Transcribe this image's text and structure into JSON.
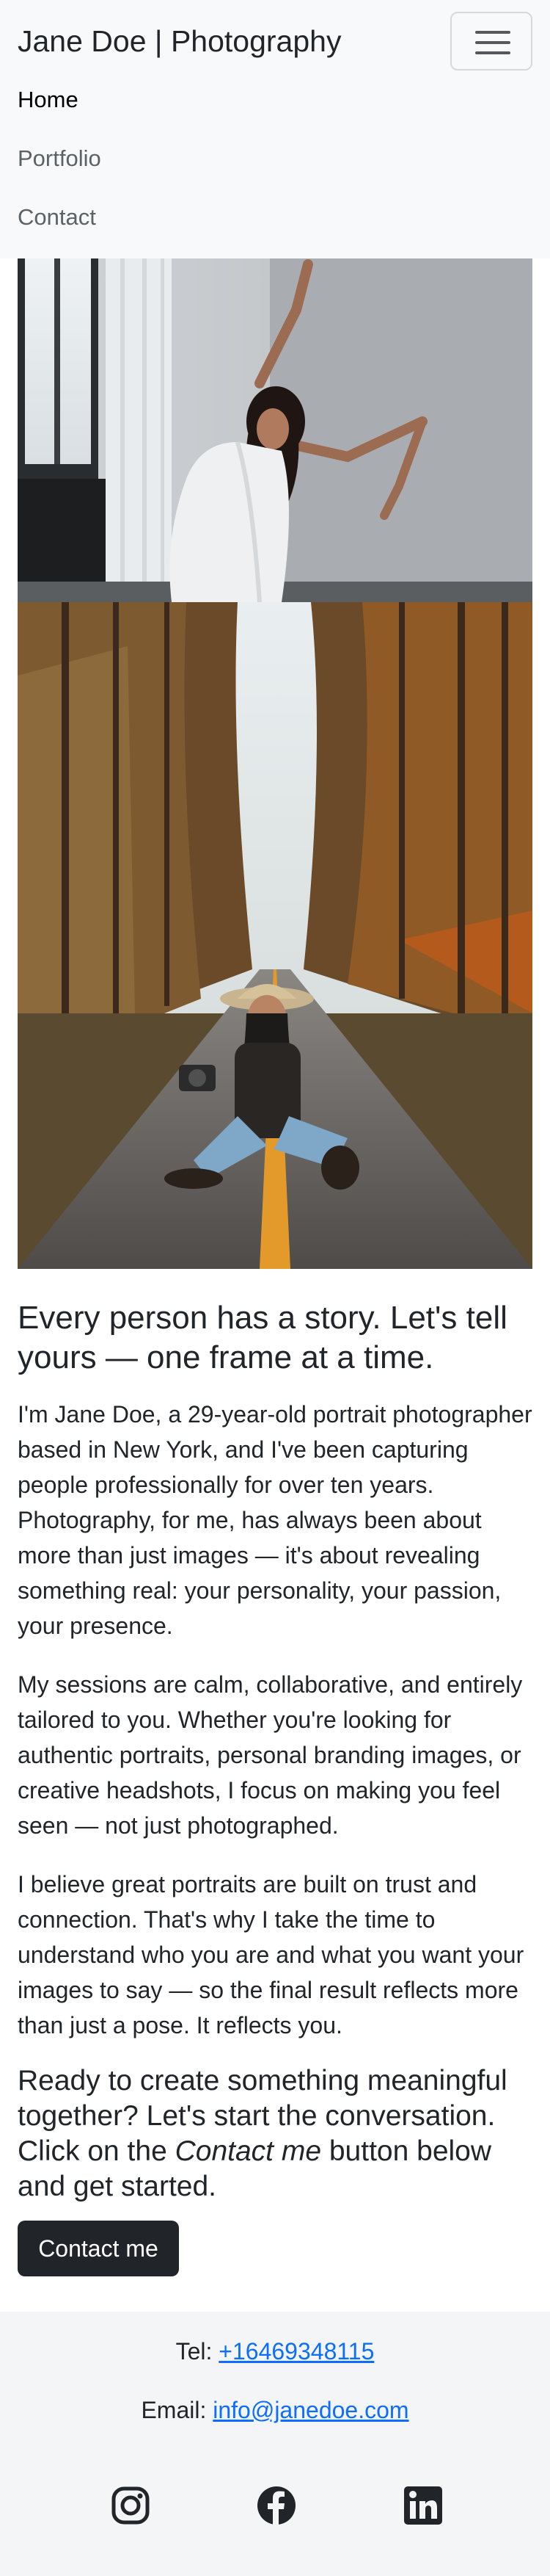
{
  "navbar": {
    "brand": "Jane Doe | Photography",
    "toggler_icon": "hamburger-menu-icon",
    "items": [
      {
        "label": "Home",
        "active": true
      },
      {
        "label": "Portfolio",
        "active": false
      },
      {
        "label": "Contact",
        "active": false
      }
    ]
  },
  "photos": [
    {
      "subject": "dancer in white leotard posing by a window"
    },
    {
      "subject": "woman in hat sitting on a forest road holding a camera"
    }
  ],
  "main": {
    "headline": "Every person has a story. Let's tell yours — one frame at a time.",
    "paragraphs": [
      "I'm Jane Doe, a 29-year-old portrait photographer based in New York, and I've been capturing people professionally for over ten years. Photography, for me, has always been about more than just images — it's about revealing something real: your personality, your passion, your presence.",
      "My sessions are calm, collaborative, and entirely tailored to you. Whether you're looking for authentic portraits, personal branding images, or creative headshots, I focus on making you feel seen — not just photographed.",
      "I believe great portraits are built on trust and connection. That's why I take the time to understand who you are and what you want your images to say — so the final result reflects more than just a pose. It reflects you."
    ],
    "cta": {
      "heading_before": "Ready to create something meaningful together? Let's start the conversation. Click on the ",
      "heading_emphasis": "Contact me",
      "heading_after": " button below and get started.",
      "button_label": "Contact me"
    }
  },
  "footer": {
    "tel_label": "Tel: ",
    "tel_value": "+16469348115",
    "email_label": "Email: ",
    "email_value": "info@janedoe.com",
    "social_icons": [
      "instagram-icon",
      "facebook-icon",
      "linkedin-icon"
    ]
  },
  "colors": {
    "navbar_bg": "#f8f9fa",
    "footer_bg": "#f4f5f6",
    "text": "#212529",
    "link": "#0d6efd",
    "button_bg": "#212529",
    "button_text": "#ffffff"
  }
}
